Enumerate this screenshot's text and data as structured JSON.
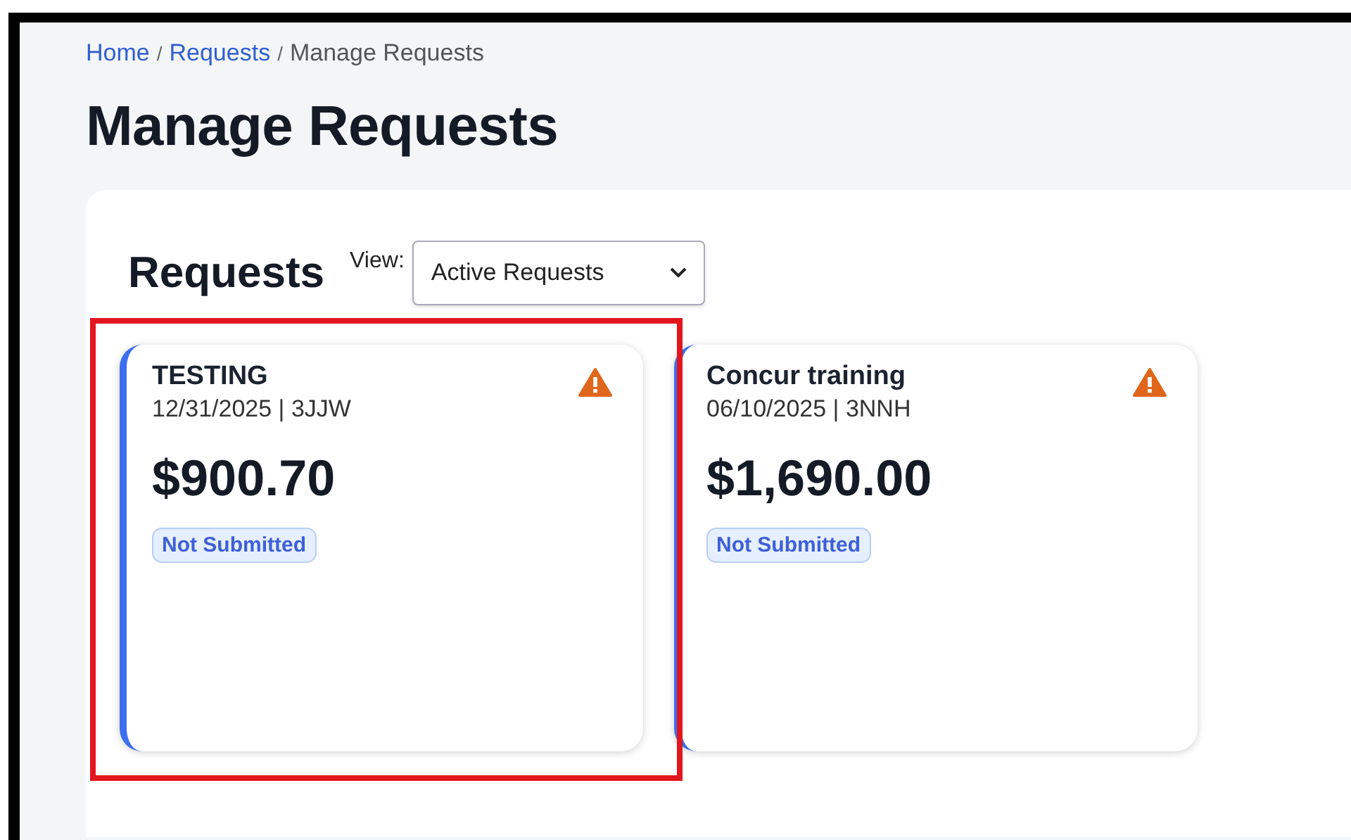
{
  "breadcrumb": [
    {
      "kind": "link",
      "label": "Home"
    },
    {
      "kind": "separator",
      "label": "/"
    },
    {
      "kind": "link",
      "label": "Requests"
    },
    {
      "kind": "separator",
      "label": "/"
    },
    {
      "kind": "current",
      "label": "Manage Requests"
    }
  ],
  "page_title": "Manage Requests",
  "requests_panel": {
    "heading": "Requests",
    "view_label": "View:",
    "view_select": {
      "value": "Active Requests"
    },
    "cards": [
      {
        "title": "TESTING",
        "subtitle": "12/31/2025 | 3JJW",
        "amount": "$900.70",
        "status": "Not Submitted",
        "warning": true,
        "highlighted": true
      },
      {
        "title": "Concur training",
        "subtitle": "06/10/2025 | 3NNH",
        "amount": "$1,690.00",
        "status": "Not Submitted",
        "warning": true,
        "highlighted": false
      }
    ]
  }
}
